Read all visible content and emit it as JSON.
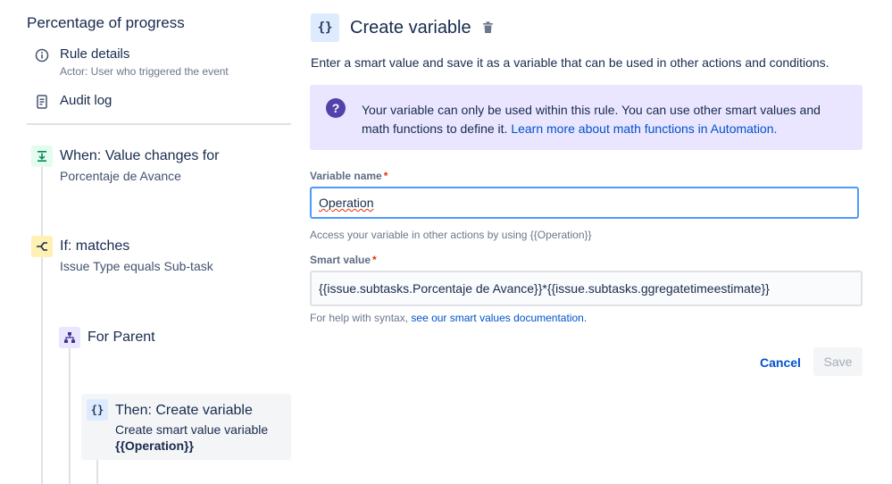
{
  "sidebar": {
    "title": "Percentage of progress",
    "rule_details": {
      "label": "Rule details",
      "sub": "Actor: User who triggered the event",
      "icon": "info-icon"
    },
    "audit_log": {
      "label": "Audit log",
      "icon": "document-icon"
    },
    "steps": [
      {
        "title": "When: Value changes for",
        "desc": "Porcentaje de Avance",
        "icon": "trigger-icon",
        "color": "#e3fcef"
      },
      {
        "title": "If: matches",
        "desc": "Issue Type equals Sub-task",
        "icon": "condition-icon",
        "color": "#fff0b3"
      },
      {
        "title": "For Parent",
        "icon": "branch-icon",
        "color": "#eae6ff"
      },
      {
        "title": "Then: Create variable",
        "desc": "Create smart value variable",
        "desc_bold": "{{Operation}}",
        "icon": "variable-icon",
        "color": "#deebff"
      }
    ]
  },
  "main": {
    "icon_glyph": "{}",
    "title": "Create variable",
    "description": "Enter a smart value and save it as a variable that can be used in other actions and conditions.",
    "info": {
      "icon": "question-icon",
      "text": "Your variable can only be used within this rule. You can use other smart values and math functions to define it.",
      "link": "Learn more about math functions in Automation."
    },
    "variable_name": {
      "label": "Variable name",
      "required": "*",
      "value": "Operation",
      "help": "Access your variable in other actions by using {{Operation}}"
    },
    "smart_value": {
      "label": "Smart value",
      "required": "*",
      "value": "{{issue.subtasks.Porcentaje de Avance}}*{{issue.subtasks.ggregatetimeestimate}}",
      "help_prefix": "For help with syntax,",
      "help_link": "see our smart values documentation."
    },
    "cancel_label": "Cancel",
    "save_label": "Save"
  }
}
